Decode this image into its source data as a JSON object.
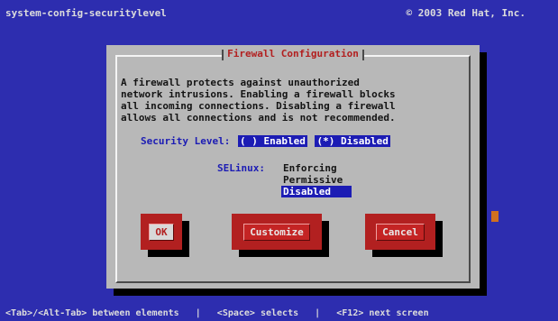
{
  "header": {
    "app_name": "system-config-securitylevel",
    "copyright": "© 2003 Red Hat, Inc."
  },
  "dialog": {
    "title": "Firewall Configuration",
    "description": "A firewall protects against unauthorized\nnetwork intrusions. Enabling a firewall blocks\nall incoming connections. Disabling a firewall\nallows all connections and is not recommended."
  },
  "security_level": {
    "label": "Security Level:",
    "options": [
      {
        "text": "( ) Enabled",
        "selected": false
      },
      {
        "text": "(*) Disabled",
        "selected": true
      }
    ]
  },
  "selinux": {
    "label": "SELinux:",
    "options": [
      "Enforcing",
      "Permissive",
      "Disabled"
    ],
    "selected": "Disabled"
  },
  "buttons": {
    "ok": "OK",
    "customize": "Customize",
    "cancel": "Cancel"
  },
  "help_bar": "<Tab>/<Alt-Tab> between elements   |   <Space> selects   |   <F12> next screen",
  "colors": {
    "background": "#2d2daf",
    "dialog": "#b8b8b8",
    "button": "#b22020",
    "highlight": "#1c1cb4"
  }
}
